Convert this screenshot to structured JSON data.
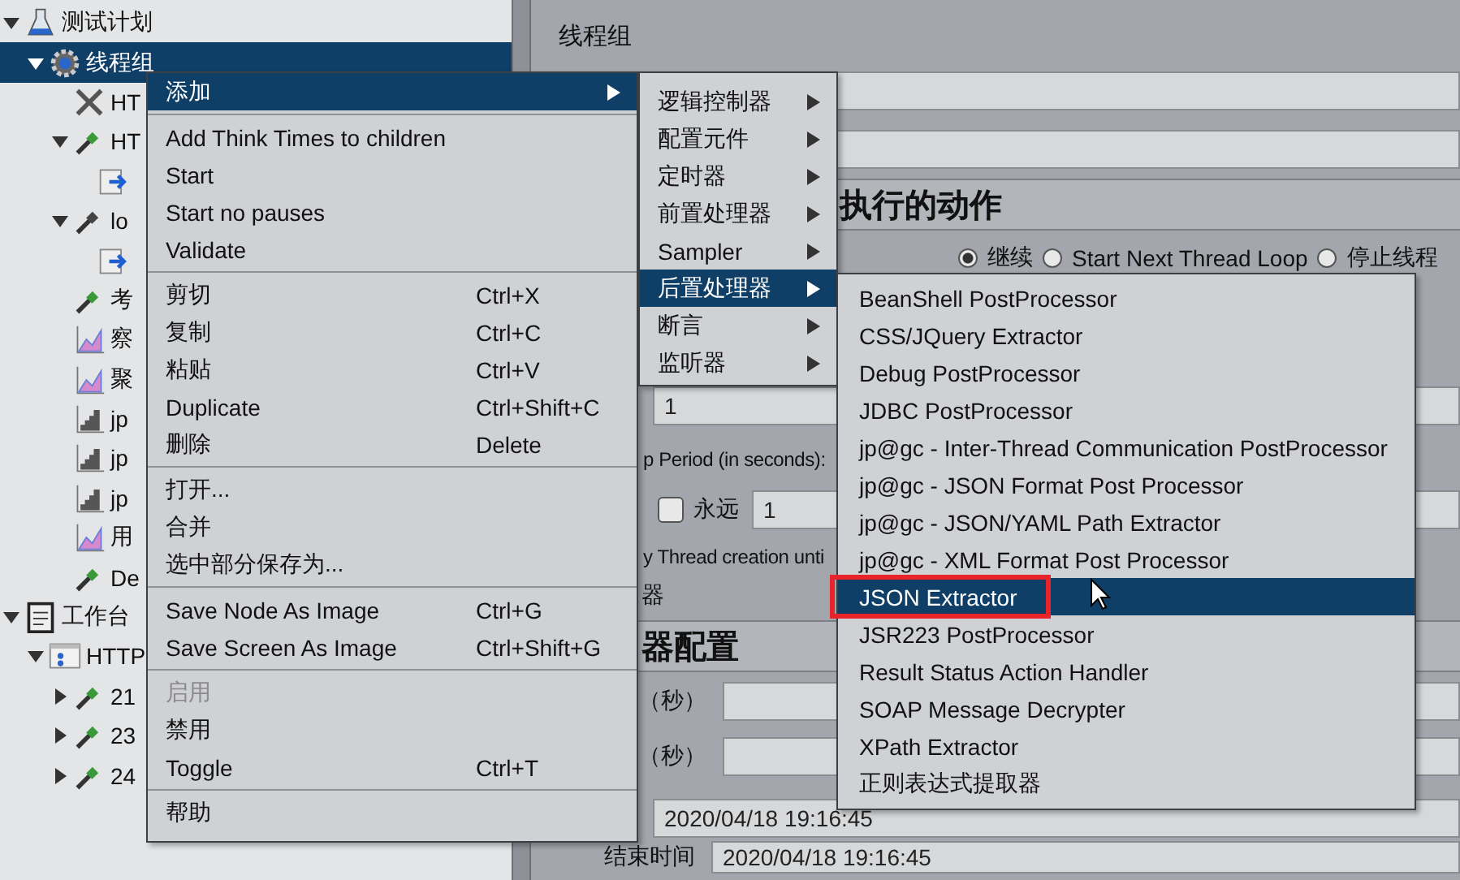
{
  "tree": {
    "items": [
      {
        "label": "测试计划",
        "kind": "test-plan",
        "selected": false,
        "expanded": true,
        "children": [
          {
            "label": "线程组",
            "kind": "thread-group",
            "selected": true,
            "expanded": true,
            "children": [
              {
                "label": "HT",
                "kind": "config",
                "selected": false
              },
              {
                "label": "HT",
                "kind": "extractor",
                "selected": false,
                "expanded": true,
                "children": [
                  {
                    "kind": "script",
                    "selected": false
                  }
                ]
              },
              {
                "label": "lo",
                "kind": "extractor-dark",
                "selected": false,
                "expanded": true,
                "children": [
                  {
                    "kind": "script",
                    "selected": false
                  }
                ]
              },
              {
                "label": "考",
                "kind": "extractor",
                "selected": false
              },
              {
                "label": "察",
                "kind": "listener",
                "selected": false
              },
              {
                "label": "聚",
                "kind": "listener",
                "selected": false
              },
              {
                "label": "jp",
                "kind": "graph",
                "selected": false
              },
              {
                "label": "jp",
                "kind": "graph",
                "selected": false
              },
              {
                "label": "jp",
                "kind": "graph",
                "selected": false
              },
              {
                "label": "用",
                "kind": "listener",
                "selected": false
              },
              {
                "label": "De",
                "kind": "extractor",
                "selected": false
              }
            ]
          }
        ]
      },
      {
        "label": "工作台",
        "kind": "workbench",
        "selected": false,
        "expanded": true,
        "children": [
          {
            "label": "HTTP",
            "kind": "recorder",
            "selected": false,
            "expanded": true,
            "children": [
              {
                "label": "21",
                "kind": "extractor",
                "selected": false,
                "expanded": false
              },
              {
                "label": "23",
                "kind": "extractor",
                "selected": false,
                "expanded": false
              },
              {
                "label": "24",
                "kind": "extractor",
                "selected": false,
                "expanded": false
              }
            ]
          }
        ]
      }
    ]
  },
  "editor": {
    "title": "线程组",
    "section_heading": "执行的动作",
    "error_options": [
      {
        "label": "继续",
        "selected": true
      },
      {
        "label": "Start Next Thread Loop",
        "selected": false
      },
      {
        "label": "停止线程",
        "selected": false
      }
    ],
    "thread_count": "1",
    "ramp_up_label": "p Period (in seconds):",
    "loop_forever": {
      "label": "永远",
      "checked": false
    },
    "loop_count": "1",
    "delay_label": "y Thread creation unti",
    "scheduler_label": "器",
    "scheduler_heading": "器配置",
    "duration_label": "（秒）",
    "startup_delay_label": "（秒）",
    "start_time": "2020/04/18 19:16:45",
    "end_time_label": "结束时间",
    "end_time": "2020/04/18 19:16:45"
  },
  "context_menu": {
    "items": [
      {
        "kind": "item",
        "label": "添加",
        "has_submenu": true,
        "selected": true,
        "disabled": false
      },
      {
        "kind": "separator"
      },
      {
        "kind": "item",
        "label": "Add Think Times to children",
        "has_submenu": false,
        "selected": false,
        "disabled": false
      },
      {
        "kind": "item",
        "label": "Start",
        "has_submenu": false,
        "selected": false,
        "disabled": false
      },
      {
        "kind": "item",
        "label": "Start no pauses",
        "has_submenu": false,
        "selected": false,
        "disabled": false
      },
      {
        "kind": "item",
        "label": "Validate",
        "has_submenu": false,
        "selected": false,
        "disabled": false
      },
      {
        "kind": "separator"
      },
      {
        "kind": "item",
        "label": "剪切",
        "shortcut": "Ctrl+X",
        "has_submenu": false,
        "selected": false,
        "disabled": false
      },
      {
        "kind": "item",
        "label": "复制",
        "shortcut": "Ctrl+C",
        "has_submenu": false,
        "selected": false,
        "disabled": false
      },
      {
        "kind": "item",
        "label": "粘贴",
        "shortcut": "Ctrl+V",
        "has_submenu": false,
        "selected": false,
        "disabled": false
      },
      {
        "kind": "item",
        "label": "Duplicate",
        "shortcut": "Ctrl+Shift+C",
        "has_submenu": false,
        "selected": false,
        "disabled": false
      },
      {
        "kind": "item",
        "label": "删除",
        "shortcut": "Delete",
        "has_submenu": false,
        "selected": false,
        "disabled": false
      },
      {
        "kind": "separator"
      },
      {
        "kind": "item",
        "label": "打开...",
        "has_submenu": false,
        "selected": false,
        "disabled": false
      },
      {
        "kind": "item",
        "label": "合并",
        "has_submenu": false,
        "selected": false,
        "disabled": false
      },
      {
        "kind": "item",
        "label": "选中部分保存为...",
        "has_submenu": false,
        "selected": false,
        "disabled": false
      },
      {
        "kind": "separator"
      },
      {
        "kind": "item",
        "label": "Save Node As Image",
        "shortcut": "Ctrl+G",
        "has_submenu": false,
        "selected": false,
        "disabled": false
      },
      {
        "kind": "item",
        "label": "Save Screen As Image",
        "shortcut": "Ctrl+Shift+G",
        "has_submenu": false,
        "selected": false,
        "disabled": false
      },
      {
        "kind": "separator"
      },
      {
        "kind": "item",
        "label": "启用",
        "has_submenu": false,
        "selected": false,
        "disabled": true
      },
      {
        "kind": "item",
        "label": "禁用",
        "has_submenu": false,
        "selected": false,
        "disabled": false
      },
      {
        "kind": "item",
        "label": "Toggle",
        "shortcut": "Ctrl+T",
        "has_submenu": false,
        "selected": false,
        "disabled": false
      },
      {
        "kind": "separator"
      },
      {
        "kind": "item",
        "label": "帮助",
        "has_submenu": false,
        "selected": false,
        "disabled": false
      }
    ]
  },
  "add_submenu": {
    "items": [
      {
        "label": "逻辑控制器",
        "selected": false
      },
      {
        "label": "配置元件",
        "selected": false
      },
      {
        "label": "定时器",
        "selected": false
      },
      {
        "label": "前置处理器",
        "selected": false
      },
      {
        "label": "Sampler",
        "selected": false
      },
      {
        "label": "后置处理器",
        "selected": true
      },
      {
        "label": "断言",
        "selected": false
      },
      {
        "label": "监听器",
        "selected": false
      }
    ]
  },
  "post_processor_submenu": {
    "items": [
      {
        "label": "BeanShell PostProcessor",
        "selected": false,
        "highlighted": false
      },
      {
        "label": "CSS/JQuery Extractor",
        "selected": false,
        "highlighted": false
      },
      {
        "label": "Debug PostProcessor",
        "selected": false,
        "highlighted": false
      },
      {
        "label": "JDBC PostProcessor",
        "selected": false,
        "highlighted": false
      },
      {
        "label": "jp@gc - Inter-Thread Communication PostProcessor",
        "selected": false,
        "highlighted": false
      },
      {
        "label": "jp@gc - JSON Format Post Processor",
        "selected": false,
        "highlighted": false
      },
      {
        "label": "jp@gc - JSON/YAML Path Extractor",
        "selected": false,
        "highlighted": false
      },
      {
        "label": "jp@gc - XML Format Post Processor",
        "selected": false,
        "highlighted": false
      },
      {
        "label": "JSON Extractor",
        "selected": true,
        "highlighted": true
      },
      {
        "label": "JSR223 PostProcessor",
        "selected": false,
        "highlighted": false
      },
      {
        "label": "Result Status Action Handler",
        "selected": false,
        "highlighted": false
      },
      {
        "label": "SOAP Message Decrypter",
        "selected": false,
        "highlighted": false
      },
      {
        "label": "XPath Extractor",
        "selected": false,
        "highlighted": false
      },
      {
        "label": "正则表达式提取器",
        "selected": false,
        "highlighted": false
      }
    ]
  }
}
